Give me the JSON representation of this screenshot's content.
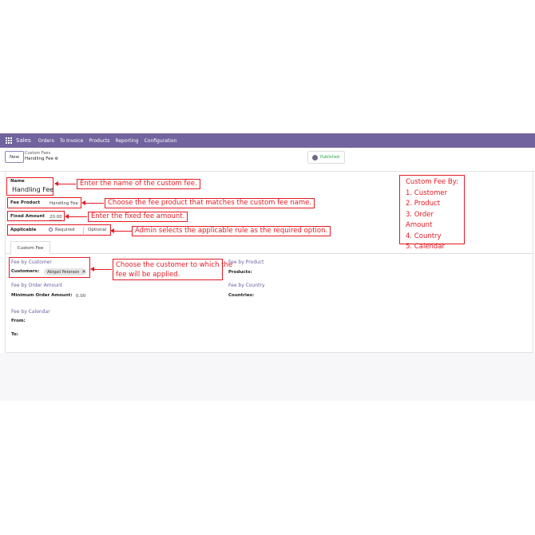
{
  "navbar": {
    "app_name": "Sales",
    "menu": [
      "Orders",
      "To Invoice",
      "Products",
      "Reporting",
      "Configuration"
    ]
  },
  "control": {
    "new_label": "New",
    "breadcrumb_parent": "Custom Fees",
    "breadcrumb_current": "Handling Fee",
    "published_label": "Published"
  },
  "form": {
    "name_label": "Name",
    "name_value": "Handling Fee",
    "fee_product_label": "Fee Product",
    "fee_product_value": "Handling Fee",
    "fixed_amount_label": "Fixed Amount",
    "fixed_amount_value": "20.00",
    "applicable_label": "Applicable",
    "applicable_required": "Required",
    "applicable_optional": "Optional",
    "applicable_selected": "Required",
    "tab_label": "Custom Fee",
    "fee_by_customer": "Fee by Customer",
    "customers_label": "Customers:",
    "customer_tag": "Abigail Peterson",
    "fee_by_product": "Fee by Product",
    "products_label": "Products:",
    "fee_by_order_amount": "Fee by Order Amount",
    "min_order_label": "Minimum Order Amount:",
    "min_order_value": "0.00",
    "fee_by_country": "Fee by Country",
    "countries_label": "Countries:",
    "fee_by_calendar": "Fee by Calendar",
    "from_label": "From:",
    "to_label": "To:"
  },
  "annotations": {
    "name": "Enter the name of the custom fee.",
    "product": "Choose the fee product that matches the custom fee name.",
    "amount": "Enter the fixed fee amount.",
    "applicable": "Admin selects the applicable rule as the required option.",
    "customer_line1": "Choose the customer to which the",
    "customer_line2": "fee will be applied.",
    "side_title": "Custom Fee By:",
    "side_items": [
      "1. Customer",
      "2. Product",
      "3. Order Amount",
      "4. Country",
      "5. Calendar"
    ]
  },
  "colors": {
    "navbar": "#71639e",
    "annotation": "#e31b23",
    "published": "#28a745"
  }
}
